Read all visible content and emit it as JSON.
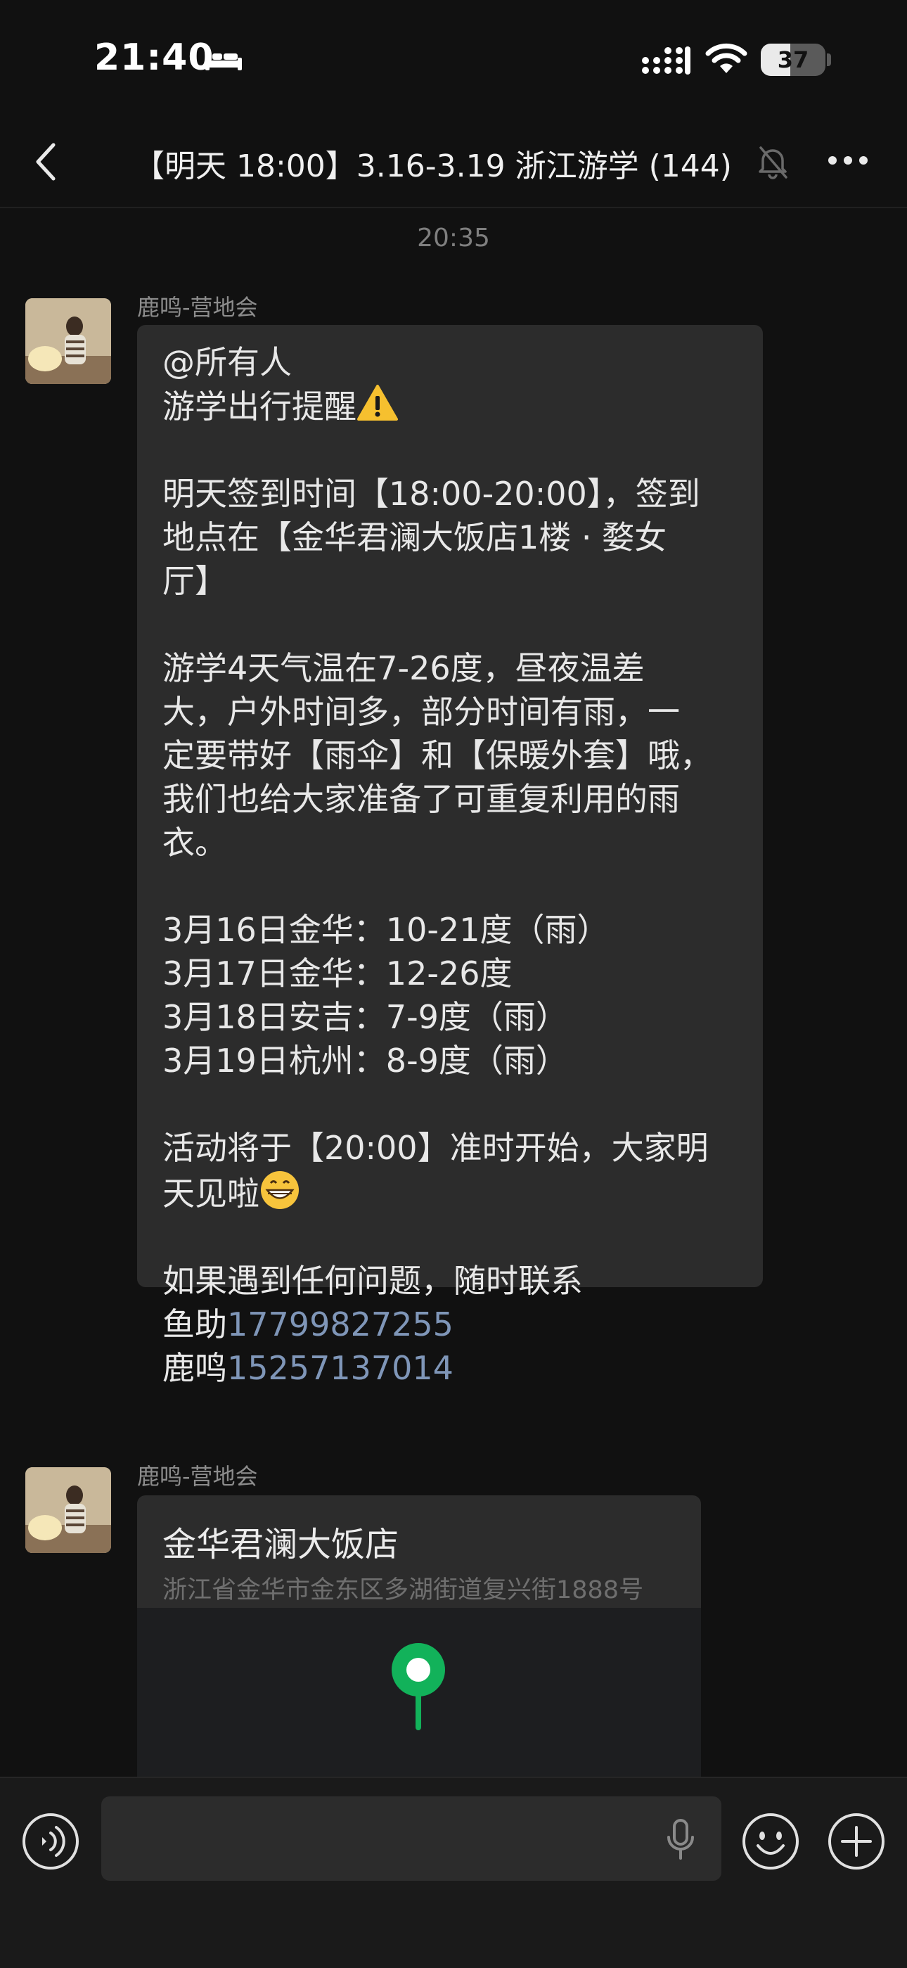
{
  "status_bar": {
    "time": "21:40",
    "battery": "37",
    "icons": [
      "bed-icon",
      "signal-icon",
      "wifi-icon",
      "battery-icon"
    ]
  },
  "nav": {
    "back_icon": "chevron-left-icon",
    "title": "【明天 18:00】3.16-3.19 浙江游学 (144)",
    "mute_icon": "bell-muted-icon",
    "more_icon": "more-dots-icon"
  },
  "chat": {
    "timestamp": "20:35",
    "messages": [
      {
        "sender": "鹿鸣-营地会",
        "lines": [
          "@所有人",
          "游学出行提醒",
          "",
          "明天签到时间【18:00-20:00】，签到",
          "地点在【金华君澜大饭店1楼 · 婺女",
          "厅】",
          "",
          "游学4天气温在7-26度，昼夜温差",
          "大，户外时间多，部分时间有雨，一",
          "定要带好【雨伞】和【保暖外套】哦，",
          "我们也给大家准备了可重复利用的雨",
          "衣。",
          "",
          "3月16日金华：10-21度（雨）",
          "3月17日金华：12-26度",
          "3月18日安吉：7-9度（雨）",
          "3月19日杭州：8-9度（雨）",
          "",
          "活动将于【20:00】准时开始，大家明",
          "天见啦",
          "",
          "如果遇到任何问题，随时联系"
        ],
        "contacts": [
          {
            "name": "鱼助",
            "phone": "17799827255"
          },
          {
            "name": "鹿鸣",
            "phone": "15257137014"
          }
        ]
      },
      {
        "sender": "鹿鸣-营地会",
        "location": {
          "name": "金华君澜大饭店",
          "address": "浙江省金华市金东区多湖街道复兴街1888号"
        }
      }
    ]
  },
  "input_bar": {
    "voice_icon": "voice-icon",
    "mic_icon": "mic-icon",
    "emoji_icon": "emoji-icon",
    "plus_icon": "plus-icon"
  }
}
